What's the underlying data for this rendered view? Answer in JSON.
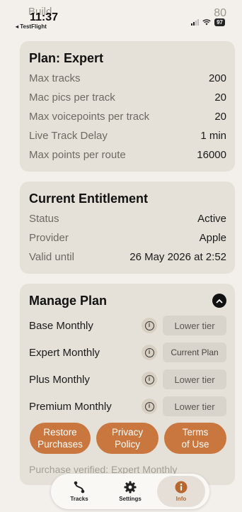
{
  "status_bar": {
    "ghost_left": "Build",
    "ghost_right": "80",
    "time": "11:37",
    "back_app": "◂ TestFlight",
    "battery": "97"
  },
  "plan": {
    "title": "Plan: Expert",
    "rows": [
      {
        "label": "Max tracks",
        "value": "200"
      },
      {
        "label": "Mac pics per track",
        "value": "20"
      },
      {
        "label": "Max voicepoints per track",
        "value": "20"
      },
      {
        "label": "Live Track Delay",
        "value": "1 min"
      },
      {
        "label": "Max points per route",
        "value": "16000"
      }
    ]
  },
  "entitlement": {
    "title": "Current Entitlement",
    "rows": [
      {
        "label": "Status",
        "value": "Active"
      },
      {
        "label": "Provider",
        "value": "Apple"
      },
      {
        "label": "Valid until",
        "value": "26 May 2026 at 2:52"
      }
    ]
  },
  "manage": {
    "title": "Manage Plan",
    "plans": [
      {
        "name": "Base Monthly",
        "action": "Lower tier"
      },
      {
        "name": "Expert Monthly",
        "action": "Current Plan"
      },
      {
        "name": "Plus Monthly",
        "action": "Lower tier"
      },
      {
        "name": "Premium Monthly",
        "action": "Lower tier"
      }
    ],
    "buttons": {
      "restore_1": "Restore",
      "restore_2": "Purchases",
      "privacy_1": "Privacy",
      "privacy_2": "Policy",
      "terms_1": "Terms",
      "terms_2": "of Use"
    },
    "verified": "Purchase verified: Expert Monthly"
  },
  "tabbar": {
    "tracks": "Tracks",
    "settings": "Settings",
    "info": "Info"
  },
  "colors": {
    "accent": "#c9773f",
    "background": "#f3f0eb",
    "card": "#e6e1d8"
  }
}
